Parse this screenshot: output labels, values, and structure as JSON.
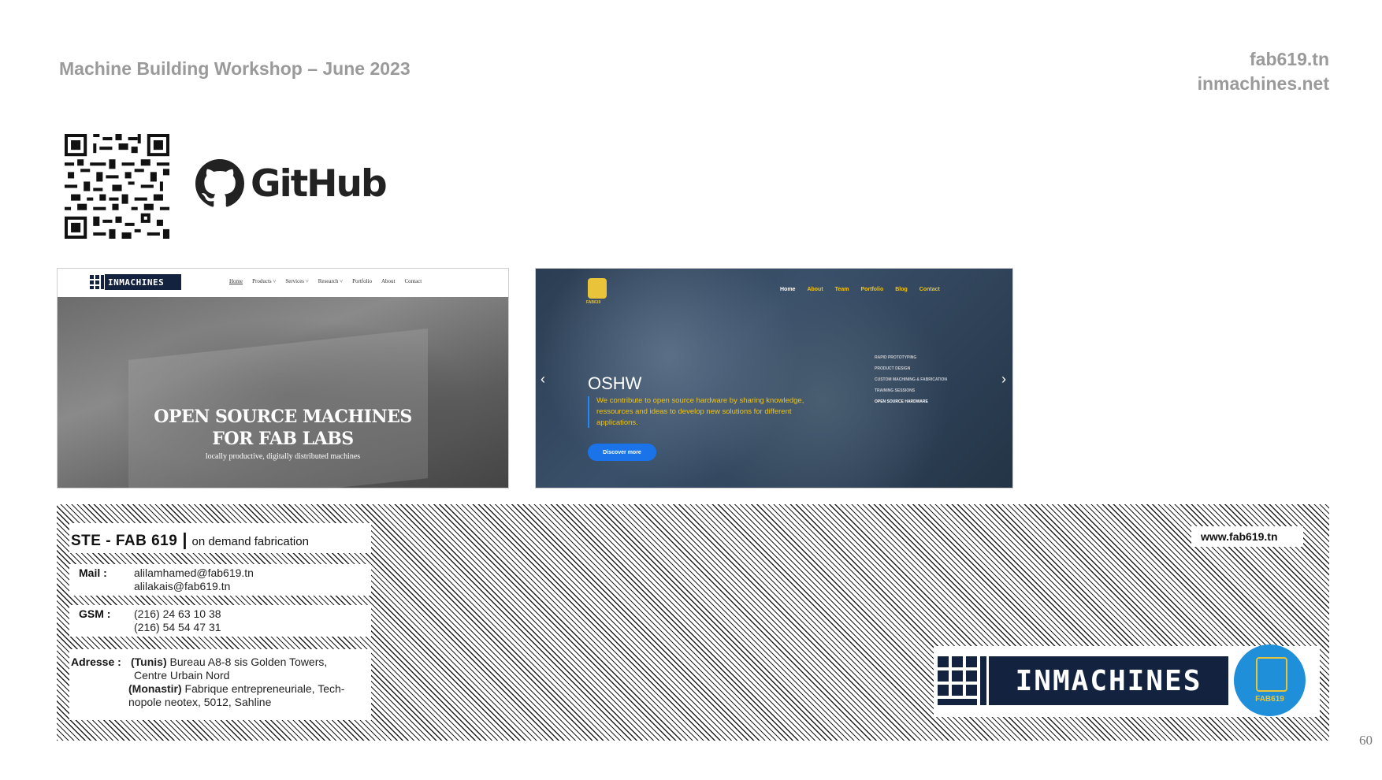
{
  "header": {
    "title": "Machine Building Workshop – June 2023",
    "site_1": "fab619.tn",
    "site_2": "inmachines.net"
  },
  "github": {
    "icon": "github-octocat-icon",
    "word": "GitHub"
  },
  "qr": {
    "icon": "qr-code-icon"
  },
  "inmachines_site": {
    "logo_text": "INMACHINES",
    "nav": [
      "Home",
      "Products ˅",
      "Services ˅",
      "Research ˅",
      "Portfolio",
      "About",
      "Contact"
    ],
    "hero_line1": "OPEN SOURCE MACHINES",
    "hero_line2": "FOR FAB LABS",
    "hero_sub": "locally productive, digitally distributed machines"
  },
  "fab619_site": {
    "logo_text": "FAB619",
    "nav": [
      "Home",
      "About",
      "Team",
      "Portfolio",
      "Blog",
      "Contact"
    ],
    "services": [
      "RAPID PROTOTYPING",
      "PRODUCT DESIGN",
      "CUSTOM MACHINING & FABRICATION",
      "TRAINING SESSIONS",
      "OPEN SOURCE HARDWARE"
    ],
    "title": "OSHW",
    "desc": "We contribute to open source hardware by sharing knowledge, ressources and ideas to develop new solutions for different applications.",
    "button": "Discover more",
    "prev": "‹",
    "next": "›"
  },
  "contact": {
    "company": "STE - FAB 619",
    "separator": "|",
    "tagline": "on demand fabrication",
    "mail_label": "Mail :",
    "mail_1": "alilamhamed@fab619.tn",
    "mail_2": "alilakais@fab619.tn",
    "gsm_label": "GSM :",
    "gsm_1": "(216) 24 63 10 38",
    "gsm_2": "(216) 54 54 47 31",
    "address_label": "Adresse :",
    "addr_city_1": "(Tunis)",
    "addr_1a": " Bureau A8-8 sis Golden Towers,",
    "addr_1b": "Centre Urbain Nord",
    "addr_city_2": "(Monastir)",
    "addr_2a": " Fabrique entrepreneuriale, Tech-",
    "addr_2b": "nopole neotex, 5012, Sahline",
    "website": "www.fab619.tn"
  },
  "brand": {
    "inmachines": "INMACHINES",
    "fab619": "FAB619",
    "accent_navy": "#13233f",
    "accent_blue": "#1e8fd8",
    "accent_yellow": "#e9c43a"
  },
  "page_number": "60"
}
